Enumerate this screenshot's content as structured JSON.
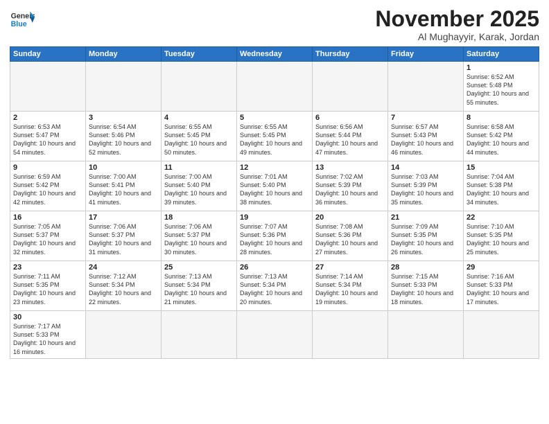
{
  "logo": {
    "text_general": "General",
    "text_blue": "Blue"
  },
  "title": "November 2025",
  "subtitle": "Al Mughayyir, Karak, Jordan",
  "days_of_week": [
    "Sunday",
    "Monday",
    "Tuesday",
    "Wednesday",
    "Thursday",
    "Friday",
    "Saturday"
  ],
  "weeks": [
    [
      {
        "day": "",
        "info": ""
      },
      {
        "day": "",
        "info": ""
      },
      {
        "day": "",
        "info": ""
      },
      {
        "day": "",
        "info": ""
      },
      {
        "day": "",
        "info": ""
      },
      {
        "day": "",
        "info": ""
      },
      {
        "day": "1",
        "info": "Sunrise: 6:52 AM\nSunset: 5:48 PM\nDaylight: 10 hours and 55 minutes."
      }
    ],
    [
      {
        "day": "2",
        "info": "Sunrise: 6:53 AM\nSunset: 5:47 PM\nDaylight: 10 hours and 54 minutes."
      },
      {
        "day": "3",
        "info": "Sunrise: 6:54 AM\nSunset: 5:46 PM\nDaylight: 10 hours and 52 minutes."
      },
      {
        "day": "4",
        "info": "Sunrise: 6:55 AM\nSunset: 5:45 PM\nDaylight: 10 hours and 50 minutes."
      },
      {
        "day": "5",
        "info": "Sunrise: 6:55 AM\nSunset: 5:45 PM\nDaylight: 10 hours and 49 minutes."
      },
      {
        "day": "6",
        "info": "Sunrise: 6:56 AM\nSunset: 5:44 PM\nDaylight: 10 hours and 47 minutes."
      },
      {
        "day": "7",
        "info": "Sunrise: 6:57 AM\nSunset: 5:43 PM\nDaylight: 10 hours and 46 minutes."
      },
      {
        "day": "8",
        "info": "Sunrise: 6:58 AM\nSunset: 5:42 PM\nDaylight: 10 hours and 44 minutes."
      }
    ],
    [
      {
        "day": "9",
        "info": "Sunrise: 6:59 AM\nSunset: 5:42 PM\nDaylight: 10 hours and 42 minutes."
      },
      {
        "day": "10",
        "info": "Sunrise: 7:00 AM\nSunset: 5:41 PM\nDaylight: 10 hours and 41 minutes."
      },
      {
        "day": "11",
        "info": "Sunrise: 7:00 AM\nSunset: 5:40 PM\nDaylight: 10 hours and 39 minutes."
      },
      {
        "day": "12",
        "info": "Sunrise: 7:01 AM\nSunset: 5:40 PM\nDaylight: 10 hours and 38 minutes."
      },
      {
        "day": "13",
        "info": "Sunrise: 7:02 AM\nSunset: 5:39 PM\nDaylight: 10 hours and 36 minutes."
      },
      {
        "day": "14",
        "info": "Sunrise: 7:03 AM\nSunset: 5:39 PM\nDaylight: 10 hours and 35 minutes."
      },
      {
        "day": "15",
        "info": "Sunrise: 7:04 AM\nSunset: 5:38 PM\nDaylight: 10 hours and 34 minutes."
      }
    ],
    [
      {
        "day": "16",
        "info": "Sunrise: 7:05 AM\nSunset: 5:37 PM\nDaylight: 10 hours and 32 minutes."
      },
      {
        "day": "17",
        "info": "Sunrise: 7:06 AM\nSunset: 5:37 PM\nDaylight: 10 hours and 31 minutes."
      },
      {
        "day": "18",
        "info": "Sunrise: 7:06 AM\nSunset: 5:37 PM\nDaylight: 10 hours and 30 minutes."
      },
      {
        "day": "19",
        "info": "Sunrise: 7:07 AM\nSunset: 5:36 PM\nDaylight: 10 hours and 28 minutes."
      },
      {
        "day": "20",
        "info": "Sunrise: 7:08 AM\nSunset: 5:36 PM\nDaylight: 10 hours and 27 minutes."
      },
      {
        "day": "21",
        "info": "Sunrise: 7:09 AM\nSunset: 5:35 PM\nDaylight: 10 hours and 26 minutes."
      },
      {
        "day": "22",
        "info": "Sunrise: 7:10 AM\nSunset: 5:35 PM\nDaylight: 10 hours and 25 minutes."
      }
    ],
    [
      {
        "day": "23",
        "info": "Sunrise: 7:11 AM\nSunset: 5:35 PM\nDaylight: 10 hours and 23 minutes."
      },
      {
        "day": "24",
        "info": "Sunrise: 7:12 AM\nSunset: 5:34 PM\nDaylight: 10 hours and 22 minutes."
      },
      {
        "day": "25",
        "info": "Sunrise: 7:13 AM\nSunset: 5:34 PM\nDaylight: 10 hours and 21 minutes."
      },
      {
        "day": "26",
        "info": "Sunrise: 7:13 AM\nSunset: 5:34 PM\nDaylight: 10 hours and 20 minutes."
      },
      {
        "day": "27",
        "info": "Sunrise: 7:14 AM\nSunset: 5:34 PM\nDaylight: 10 hours and 19 minutes."
      },
      {
        "day": "28",
        "info": "Sunrise: 7:15 AM\nSunset: 5:33 PM\nDaylight: 10 hours and 18 minutes."
      },
      {
        "day": "29",
        "info": "Sunrise: 7:16 AM\nSunset: 5:33 PM\nDaylight: 10 hours and 17 minutes."
      }
    ],
    [
      {
        "day": "30",
        "info": "Sunrise: 7:17 AM\nSunset: 5:33 PM\nDaylight: 10 hours and 16 minutes."
      },
      {
        "day": "",
        "info": ""
      },
      {
        "day": "",
        "info": ""
      },
      {
        "day": "",
        "info": ""
      },
      {
        "day": "",
        "info": ""
      },
      {
        "day": "",
        "info": ""
      },
      {
        "day": "",
        "info": ""
      }
    ]
  ]
}
